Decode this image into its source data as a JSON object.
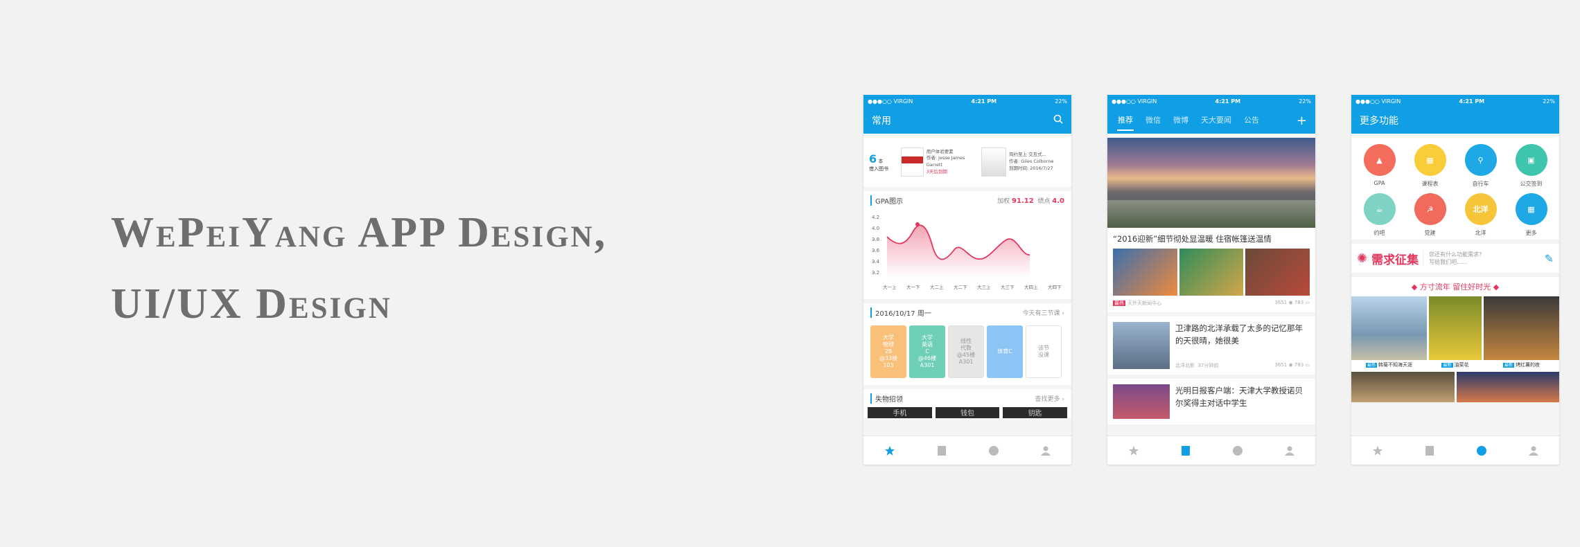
{
  "title": {
    "line1": "WePeiYang APP Design,",
    "line2": "UI/UX Design"
  },
  "status": {
    "carrier": "●●●○○ VIRGIN",
    "time": "4:21 PM",
    "battery": "22%"
  },
  "phone1": {
    "nav_title": "常用",
    "books": {
      "count": "6",
      "unit": "本",
      "label": "借入图书",
      "items": [
        {
          "title": "用户体验要素",
          "author": "作者: Jesse James Garrett",
          "due": "3天后到期"
        },
        {
          "title": "简约至上 交互式...",
          "author": "作者: Giles Colborne",
          "due": "到期时间: 2016/7/27"
        }
      ]
    },
    "gpa": {
      "title": "GPA图示",
      "weighted_label": "加权",
      "weighted": "91.12",
      "gpa_label": "绩点",
      "gpa": "4.0",
      "y_ticks": [
        "4.2",
        "4.0",
        "3.8",
        "3.6",
        "3.4",
        "3.2"
      ],
      "x_ticks": [
        "大一上",
        "大一下",
        "大二上",
        "大二下",
        "大三上",
        "大三下",
        "大四上",
        "大四下"
      ]
    },
    "schedule": {
      "date": "2016/10/17  周一",
      "hint": "今天有三节课",
      "courses": [
        {
          "name": "大学\n物理\n2B\n@33楼\n103",
          "color": "#f9c07a"
        },
        {
          "name": "大学\n英语\nC\n@46楼\nA301",
          "color": "#6fd0b7"
        },
        {
          "name": "线性\n代数\n@45楼\nA301",
          "color": "#e6e6e6"
        },
        {
          "name": "体育C",
          "color": "#8cc5f4"
        },
        {
          "name": "该节\n没课",
          "color": "#ffffff"
        }
      ]
    },
    "lost": {
      "title": "失物招领",
      "more": "查找更多",
      "items": [
        "手机",
        "钱包",
        "钥匙"
      ]
    }
  },
  "phone2": {
    "tabs": [
      "推荐",
      "微信",
      "微博",
      "天大要闻",
      "公告"
    ],
    "plus": "+",
    "news": [
      {
        "title": "“2016迎新”细节彻处显温暖 住宿帐篷送温情",
        "source": "天外天新闻中心",
        "tag": "最热",
        "views": "3651",
        "comments": "783"
      },
      {
        "title": "卫津路的北洋承载了太多的记忆那年的天很晴，她很美",
        "source": "北洋北影",
        "time": "37分钟前",
        "views": "3651",
        "comments": "783"
      },
      {
        "title": "光明日报客户端：天津大学教授诺贝尔奖得主对话中学生"
      }
    ]
  },
  "phone3": {
    "nav_title": "更多功能",
    "functions": [
      {
        "label": "GPA",
        "color": "#f46c5b",
        "glyph": "▲"
      },
      {
        "label": "课程表",
        "color": "#f9cd3a",
        "glyph": "▦"
      },
      {
        "label": "自行车",
        "color": "#1ea8e6",
        "glyph": "⚲"
      },
      {
        "label": "公交签到",
        "color": "#3fc4ae",
        "glyph": "▣"
      },
      {
        "label": "约吧",
        "color": "#7fd3c5",
        "glyph": "☕"
      },
      {
        "label": "党建",
        "color": "#f26a5b",
        "glyph": "☭"
      },
      {
        "label": "北洋",
        "color": "#f7c53a",
        "glyph": "北洋"
      },
      {
        "label": "更多",
        "color": "#1ea8e6",
        "glyph": "▦"
      }
    ],
    "banner": {
      "big": "需求征集",
      "small1": "您还有什么功能需求?",
      "small2": "写给我们吧......"
    },
    "slogan": "◆ 方寸流年 留住好时光 ◆",
    "pics": [
      {
        "tag": "最热",
        "caption": "韩菊不知海天涯"
      },
      {
        "tag": "最新",
        "caption": "油菜花"
      },
      {
        "tag": "最新",
        "caption": "烤红薯的夜"
      }
    ]
  },
  "colors": {
    "primary": "#109fe5",
    "accent": "#e3375d"
  }
}
